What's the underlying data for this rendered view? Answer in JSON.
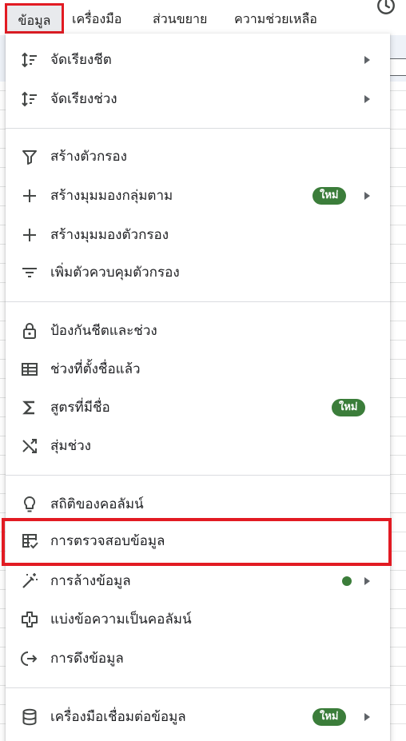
{
  "colors": {
    "highlight": "#e21b23",
    "badge_green": "#3b7d3a",
    "text": "#202124",
    "icon": "#444746",
    "divider": "#dadce0"
  },
  "menubar": {
    "items": [
      {
        "label": "ข้อมูล"
      },
      {
        "label": "เครื่องมือ"
      },
      {
        "label": "ส่วนขยาย"
      },
      {
        "label": "ความช่วยเหลือ"
      }
    ],
    "history_icon": "history-icon"
  },
  "menu": {
    "items": [
      {
        "label": "จัดเรียงชีต",
        "icon": "sort-icon",
        "submenu": true
      },
      {
        "label": "จัดเรียงช่วง",
        "icon": "sort-icon",
        "submenu": true
      },
      {
        "label": "สร้างตัวกรอง",
        "icon": "filter-icon"
      },
      {
        "label": "สร้างมุมมองกลุ่มตาม",
        "icon": "plus-icon",
        "badge": "ใหม่",
        "submenu": true
      },
      {
        "label": "สร้างมุมมองตัวกรอง",
        "icon": "plus-icon"
      },
      {
        "label": "เพิ่มตัวควบคุมตัวกรอง",
        "icon": "filter-lines-icon"
      },
      {
        "label": "ป้องกันชีตและช่วง",
        "icon": "lock-icon"
      },
      {
        "label": "ช่วงที่ตั้งชื่อแล้ว",
        "icon": "table-icon"
      },
      {
        "label": "สูตรที่มีชื่อ",
        "icon": "sigma-icon",
        "badge": "ใหม่"
      },
      {
        "label": "สุ่มช่วง",
        "icon": "shuffle-icon"
      },
      {
        "label": "สถิติของคอลัมน์",
        "icon": "lightbulb-icon"
      },
      {
        "label": "การตรวจสอบข้อมูล",
        "icon": "data-validation-icon"
      },
      {
        "label": "การล้างข้อมูล",
        "icon": "magic-wand-icon",
        "dot": true,
        "submenu": true
      },
      {
        "label": "แบ่งข้อความเป็นคอลัมน์",
        "icon": "split-columns-icon"
      },
      {
        "label": "การดึงข้อมูล",
        "icon": "extract-icon"
      },
      {
        "label": "เครื่องมือเชื่อมต่อข้อมูล",
        "icon": "database-icon",
        "badge": "ใหม่",
        "submenu": true
      }
    ]
  }
}
